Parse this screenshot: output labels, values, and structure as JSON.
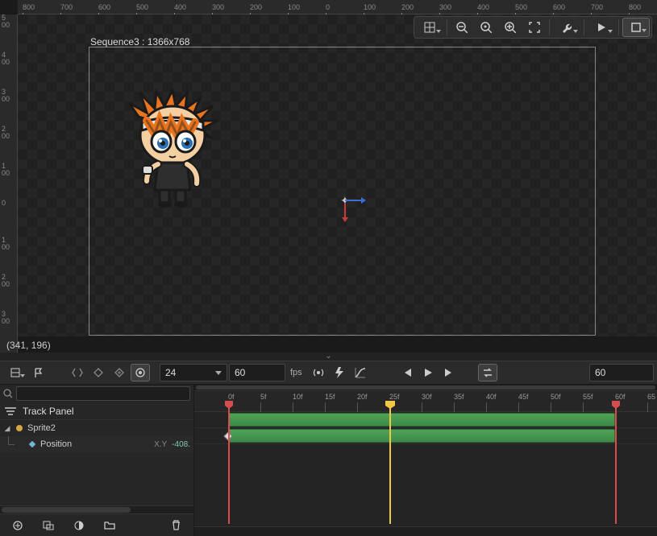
{
  "canvas": {
    "sequence_label": "Sequence3 : 1366x768",
    "cursor_coords": "(341, 196)",
    "ruler_h_ticks": [
      "800",
      "700",
      "600",
      "500",
      "400",
      "300",
      "200",
      "100",
      "0",
      "100",
      "200",
      "300",
      "400",
      "500",
      "600",
      "700",
      "800"
    ],
    "ruler_v_ticks": [
      "500",
      "400",
      "300",
      "200",
      "100",
      "0",
      "100",
      "200",
      "300"
    ]
  },
  "top_tools": {
    "grid": "grid-options",
    "zoom_out": "zoom-out",
    "zoom_reset": "zoom-reset",
    "zoom_in": "zoom-in",
    "fit": "fit-screen",
    "wrench": "tools",
    "play": "preview-play",
    "canvas": "canvas-frame"
  },
  "playback": {
    "fps_select": "24",
    "fps_value": "60",
    "fps_label": "fps",
    "current_frame": "60"
  },
  "timeline": {
    "ruler_labels": [
      "0f",
      "5f",
      "10f",
      "15f",
      "20f",
      "25f",
      "30f",
      "35f",
      "40f",
      "45f",
      "50f",
      "55f",
      "60f",
      "65"
    ],
    "playhead_frame": 25,
    "range_start": 0,
    "range_end": 60,
    "tracks": [
      {
        "name": "Sprite2",
        "clip_start": 0,
        "clip_end": 60
      },
      {
        "name": "Position",
        "clip_start": 0,
        "clip_end": 60
      }
    ]
  },
  "track_panel": {
    "title": "Track Panel",
    "search_placeholder": "",
    "items": [
      {
        "type": "asset",
        "label": "Sprite2"
      },
      {
        "type": "param",
        "label": "Position",
        "suffix": "X.Y",
        "value": "-408."
      }
    ]
  }
}
